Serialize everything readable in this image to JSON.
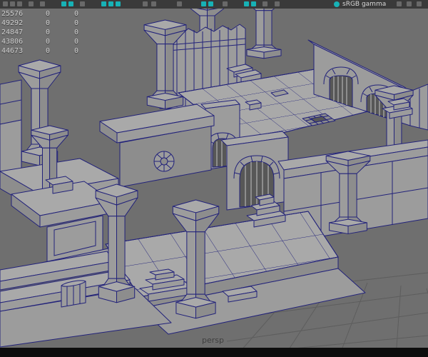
{
  "toolbar": {
    "gamma_label": "sRGB gamma"
  },
  "hud": {
    "rows": [
      {
        "c1": "25576",
        "c2": "0",
        "c3": "0"
      },
      {
        "c1": "49292",
        "c2": "0",
        "c3": "0"
      },
      {
        "c1": "24847",
        "c2": "0",
        "c3": "0"
      },
      {
        "c1": "43806",
        "c2": "0",
        "c3": "0"
      },
      {
        "c1": "44673",
        "c2": "0",
        "c3": "0"
      }
    ]
  },
  "viewport": {
    "camera_label": "persp"
  },
  "colors": {
    "viewport_bg": "#6f6f6f",
    "face_top": "#a9a9a9",
    "face_front": "#9c9c9c",
    "face_side": "#8d8d8d",
    "face_dark": "#575757",
    "wireframe": "#22227a",
    "grid_line": "#5d5d5d",
    "toolbar_bg": "#3a3a3a",
    "toolbar_icon": "#696969",
    "accent_teal": "#17b2b6",
    "hud_text": "#d0d0d0",
    "gamma_text": "#d8d8d8",
    "camera_label": "#3f3f3f",
    "bottom_bar": "#0d0d0d"
  }
}
